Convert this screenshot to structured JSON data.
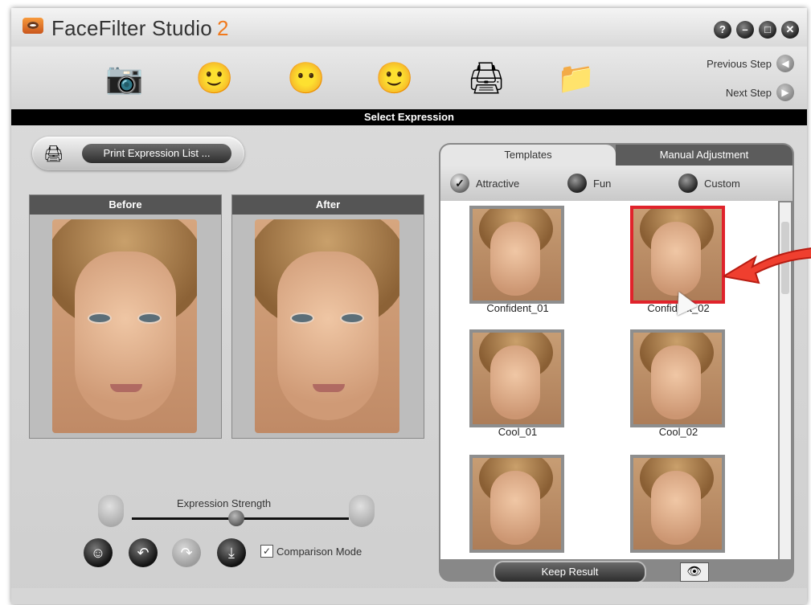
{
  "app": {
    "name": "FaceFilter Studio",
    "version": "2"
  },
  "window_controls": [
    {
      "icon": "help-icon",
      "glyph": "?"
    },
    {
      "icon": "minimize-icon",
      "glyph": "–"
    },
    {
      "icon": "maximize-icon",
      "glyph": "□"
    },
    {
      "icon": "close-icon",
      "glyph": "✕"
    }
  ],
  "toolbar": {
    "tools": [
      {
        "name": "camera-icon",
        "glyph": "📷"
      },
      {
        "name": "face-landmark-icon",
        "glyph": "🙂"
      },
      {
        "name": "makeup-face-icon",
        "glyph": "😶"
      },
      {
        "name": "expression-faces-icon",
        "glyph": "🙂"
      },
      {
        "name": "printer-icon",
        "glyph": "🖨"
      },
      {
        "name": "export-folder-icon",
        "glyph": "📁"
      }
    ],
    "previous_step": "Previous Step",
    "next_step": "Next Step"
  },
  "step_title": "Select Expression",
  "print_button": "Print Expression List ...",
  "preview": {
    "before": "Before",
    "after": "After"
  },
  "expression_strength_label": "Expression Strength",
  "strength_fraction": 0.52,
  "comparison_mode": {
    "label": "Comparison Mode",
    "checked": true
  },
  "tabs": {
    "templates": "Templates",
    "manual": "Manual Adjustment"
  },
  "filters": {
    "attractive": "Attractive",
    "fun": "Fun",
    "custom": "Custom"
  },
  "thumbnails": [
    {
      "caption": "Confident_01",
      "selected": false
    },
    {
      "caption": "Confident_02",
      "selected": true
    },
    {
      "caption": "Cool_01",
      "selected": false
    },
    {
      "caption": "Cool_02",
      "selected": false
    },
    {
      "caption": "",
      "selected": false
    },
    {
      "caption": "",
      "selected": false
    }
  ],
  "keep_result": "Keep Result",
  "colors": {
    "accent_red": "#e0232b",
    "logo_orange": "#f07a1e"
  }
}
